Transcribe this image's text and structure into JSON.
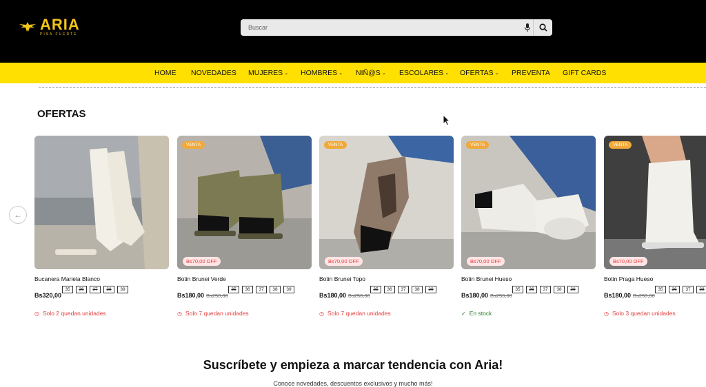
{
  "brand": {
    "name": "ARIA",
    "tagline": "PISA FUERTE",
    "accent": "#f3c51a"
  },
  "search": {
    "placeholder": "Buscar"
  },
  "nav": [
    {
      "label": "HOME",
      "dropdown": false
    },
    {
      "label": "NOVEDADES",
      "dropdown": false
    },
    {
      "label": "MUJERES",
      "dropdown": true
    },
    {
      "label": "HOMBRES",
      "dropdown": true
    },
    {
      "label": "NIÑ@S",
      "dropdown": true
    },
    {
      "label": "ESCOLARES",
      "dropdown": true
    },
    {
      "label": "OFERTAS",
      "dropdown": true
    },
    {
      "label": "PREVENTA",
      "dropdown": false
    },
    {
      "label": "GIFT CARDS",
      "dropdown": false
    }
  ],
  "section": {
    "title": "OFERTAS"
  },
  "products": [
    {
      "name": "Bucanera Mariela Blanco",
      "price": "Bs320,00",
      "old_price": "",
      "venta": "",
      "discount": "",
      "stock": "Solo 2 quedan unidades",
      "stock_type": "low",
      "sizes": [
        {
          "s": "35",
          "off": false
        },
        {
          "s": "36",
          "off": true
        },
        {
          "s": "37",
          "off": true
        },
        {
          "s": "38",
          "off": true
        },
        {
          "s": "39",
          "off": false
        }
      ]
    },
    {
      "name": "Botin Brunei Verde",
      "price": "Bs180,00",
      "old_price": "Bs250,00",
      "venta": "VENTA",
      "discount": "Bs70,00 OFF",
      "stock": "Solo 7 quedan unidades",
      "stock_type": "low",
      "sizes": [
        {
          "s": "35",
          "off": true
        },
        {
          "s": "36",
          "off": false
        },
        {
          "s": "37",
          "off": false
        },
        {
          "s": "38",
          "off": false
        },
        {
          "s": "39",
          "off": false
        }
      ]
    },
    {
      "name": "Botin Brunei Topo",
      "price": "Bs180,00",
      "old_price": "Bs250,00",
      "venta": "VENTA",
      "discount": "Bs70,00 OFF",
      "stock": "Solo 7 quedan unidades",
      "stock_type": "low",
      "sizes": [
        {
          "s": "35",
          "off": true
        },
        {
          "s": "36",
          "off": false
        },
        {
          "s": "37",
          "off": false
        },
        {
          "s": "38",
          "off": false
        },
        {
          "s": "39",
          "off": true
        }
      ]
    },
    {
      "name": "Botin Brunei Hueso",
      "price": "Bs180,00",
      "old_price": "Bs250,00",
      "venta": "VENTA",
      "discount": "Bs70,00 OFF",
      "stock": "En stock",
      "stock_type": "ok",
      "sizes": [
        {
          "s": "35",
          "off": false
        },
        {
          "s": "36",
          "off": true
        },
        {
          "s": "37",
          "off": false
        },
        {
          "s": "38",
          "off": false
        },
        {
          "s": "39",
          "off": true
        }
      ]
    },
    {
      "name": "Botin Praga Hueso",
      "price": "Bs180,00",
      "old_price": "Bs250,00",
      "venta": "VENTA",
      "discount": "Bs70,00 OFF",
      "stock": "Solo 3 quedan unidades",
      "stock_type": "low",
      "sizes": [
        {
          "s": "35",
          "off": false
        },
        {
          "s": "36",
          "off": true
        },
        {
          "s": "37",
          "off": false
        },
        {
          "s": "38",
          "off": true
        }
      ]
    }
  ],
  "subscribe": {
    "title": "Suscríbete y empieza a marcar tendencia con Aria!",
    "subtitle": "Conoce novedades, descuentos exclusivos y mucho más!"
  },
  "colors": {
    "nav_bg": "#ffe000",
    "header_bg": "#000000",
    "badge_venta": "#f0a93a",
    "sale_red": "#e23b3b",
    "stock_green": "#2b7a2b"
  }
}
